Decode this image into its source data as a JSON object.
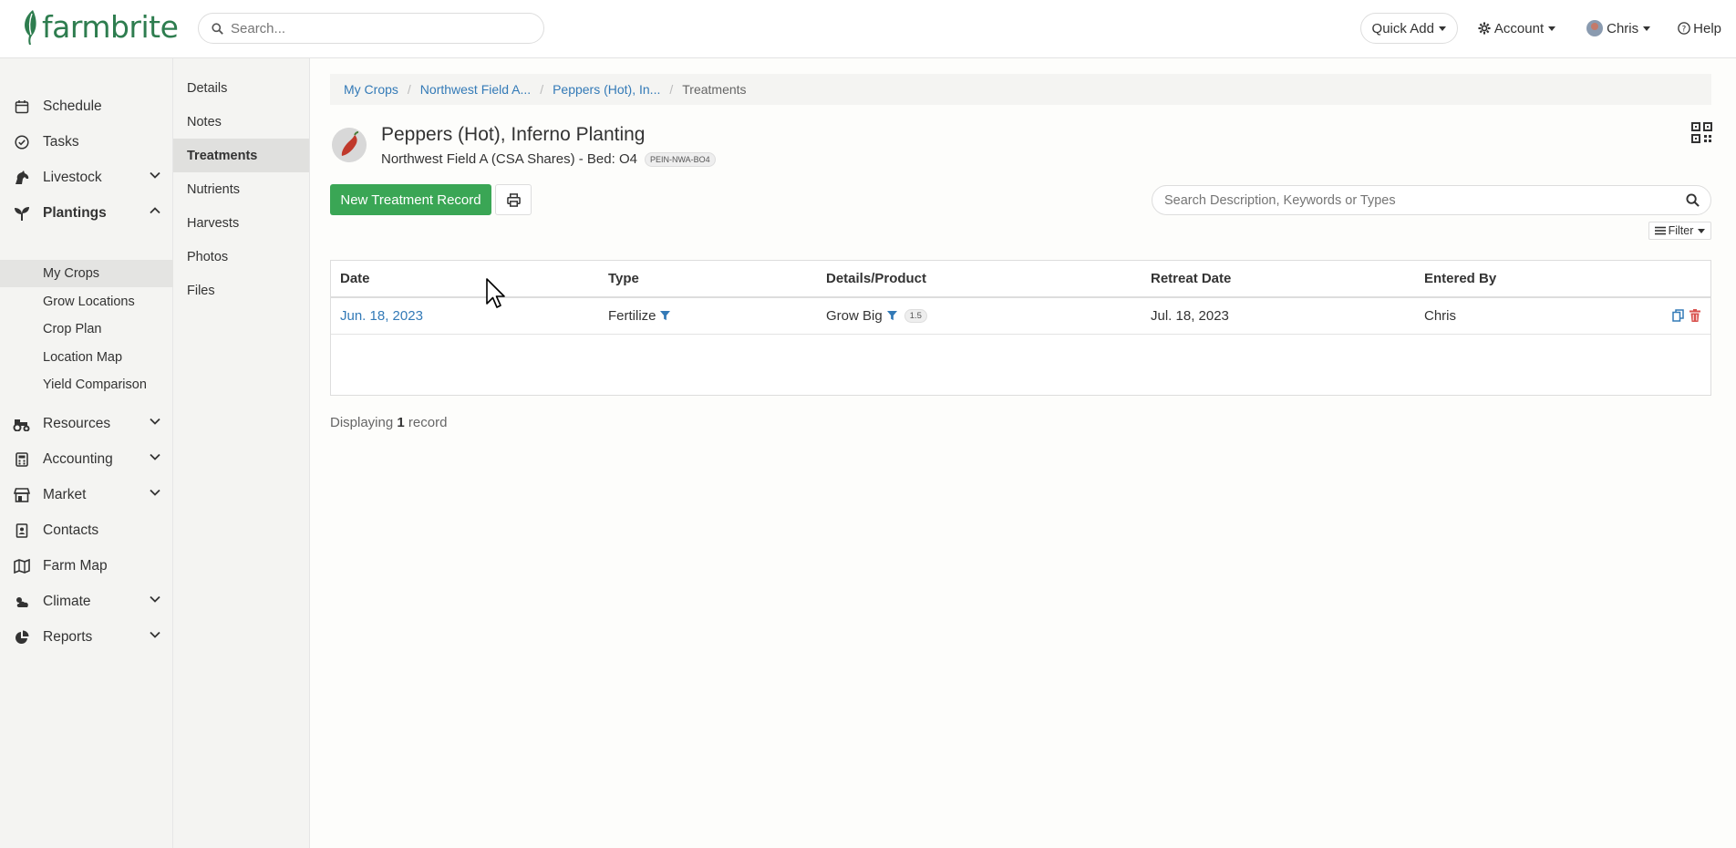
{
  "app": {
    "name": "farmbrite"
  },
  "header": {
    "search_placeholder": "Search...",
    "quick_add": "Quick Add",
    "account": "Account",
    "user": "Chris",
    "help": "Help"
  },
  "sidebar": {
    "items": [
      {
        "label": "Schedule",
        "icon": "calendar-icon"
      },
      {
        "label": "Tasks",
        "icon": "check-circle-icon"
      },
      {
        "label": "Livestock",
        "icon": "horse-icon"
      },
      {
        "label": "Plantings",
        "icon": "seedling-icon"
      },
      {
        "label": "Resources",
        "icon": "tractor-icon"
      },
      {
        "label": "Accounting",
        "icon": "calculator-icon"
      },
      {
        "label": "Market",
        "icon": "store-icon"
      },
      {
        "label": "Contacts",
        "icon": "contact-book-icon"
      },
      {
        "label": "Farm Map",
        "icon": "map-icon"
      },
      {
        "label": "Climate",
        "icon": "cloud-sun-icon"
      },
      {
        "label": "Reports",
        "icon": "pie-chart-icon"
      }
    ],
    "plantings_sub": [
      {
        "label": "My Crops"
      },
      {
        "label": "Grow Locations"
      },
      {
        "label": "Crop Plan"
      },
      {
        "label": "Location Map"
      },
      {
        "label": "Yield Comparison"
      }
    ]
  },
  "subnav": {
    "items": [
      {
        "label": "Details"
      },
      {
        "label": "Notes"
      },
      {
        "label": "Treatments"
      },
      {
        "label": "Nutrients"
      },
      {
        "label": "Harvests"
      },
      {
        "label": "Photos"
      },
      {
        "label": "Files"
      }
    ]
  },
  "breadcrumb": [
    "My Crops",
    "Northwest Field A...",
    "Peppers (Hot), In...",
    "Treatments"
  ],
  "planting": {
    "title": "Peppers (Hot), Inferno Planting",
    "location": "Northwest Field A (CSA Shares) - Bed: O4",
    "code": "PEIN-NWA-BO4"
  },
  "toolbar": {
    "new_label": "New Treatment Record",
    "search_placeholder": "Search Description, Keywords or Types",
    "filter_label": "Filter"
  },
  "table": {
    "columns": [
      "Date",
      "Type",
      "Details/Product",
      "Retreat Date",
      "Entered By"
    ],
    "rows": [
      {
        "date": "Jun. 18, 2023",
        "type": "Fertilize",
        "product": "Grow Big",
        "amount": "1.5",
        "retreat": "Jul. 18, 2023",
        "entered_by": "Chris"
      }
    ]
  },
  "footer": {
    "prefix": "Displaying",
    "count": "1",
    "suffix": "record"
  },
  "colors": {
    "brand_green": "#2e7d4f",
    "button_green": "#3aa655",
    "link_blue": "#337ab7",
    "delete_red": "#d9534f"
  }
}
